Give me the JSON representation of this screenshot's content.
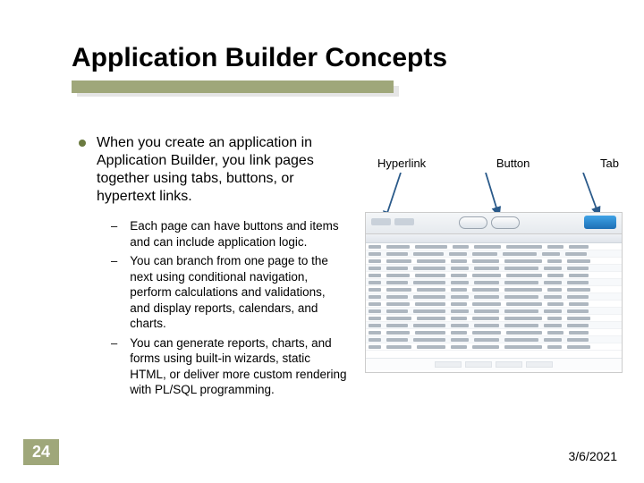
{
  "title": "Application Builder Concepts",
  "main_bullet": "When you create an application in Application Builder, you link pages together using tabs, buttons, or hypertext links.",
  "sub_bullets": [
    "Each page can have buttons and items and can include application logic.",
    "You can branch from one page to the next using conditional navigation, perform calculations and validations, and display reports, calendars, and charts.",
    "You can generate reports, charts, and forms using built-in wizards, static HTML, or deliver more custom rendering with PL/SQL programming."
  ],
  "labels": {
    "hyperlink": "Hyperlink",
    "button": "Button",
    "tab": "Tab"
  },
  "slide_number": "24",
  "slide_date": "3/6/2021"
}
